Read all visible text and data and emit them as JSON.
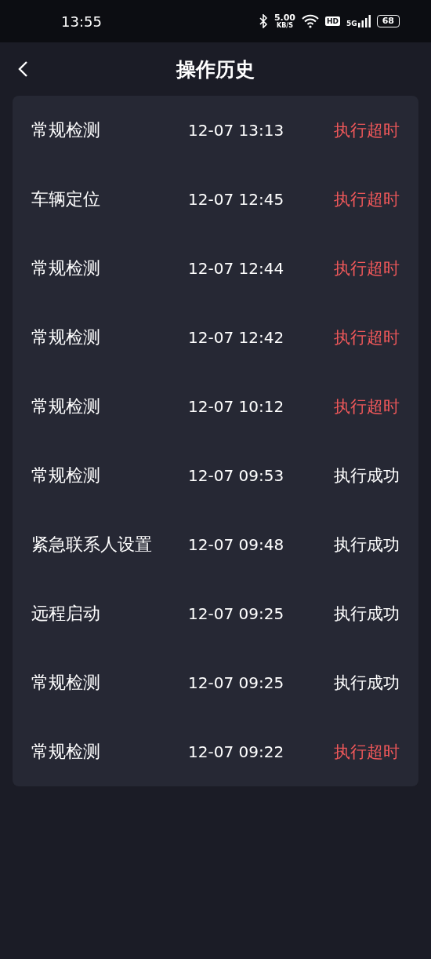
{
  "status_bar": {
    "time": "13:55",
    "speed": "5.00",
    "speed_unit": "KB/S",
    "hd": "HD",
    "network": "5G",
    "battery": "68"
  },
  "header": {
    "title": "操作历史"
  },
  "rows": [
    {
      "name": "常规检测",
      "time": "12-07 13:13",
      "result": "执行超时",
      "kind": "timeout"
    },
    {
      "name": "车辆定位",
      "time": "12-07 12:45",
      "result": "执行超时",
      "kind": "timeout"
    },
    {
      "name": "常规检测",
      "time": "12-07 12:44",
      "result": "执行超时",
      "kind": "timeout"
    },
    {
      "name": "常规检测",
      "time": "12-07 12:42",
      "result": "执行超时",
      "kind": "timeout"
    },
    {
      "name": "常规检测",
      "time": "12-07 10:12",
      "result": "执行超时",
      "kind": "timeout"
    },
    {
      "name": "常规检测",
      "time": "12-07 09:53",
      "result": "执行成功",
      "kind": "success"
    },
    {
      "name": "紧急联系人设置",
      "time": "12-07 09:48",
      "result": "执行成功",
      "kind": "success"
    },
    {
      "name": "远程启动",
      "time": "12-07 09:25",
      "result": "执行成功",
      "kind": "success"
    },
    {
      "name": "常规检测",
      "time": "12-07 09:25",
      "result": "执行成功",
      "kind": "success"
    },
    {
      "name": "常规检测",
      "time": "12-07 09:22",
      "result": "执行超时",
      "kind": "timeout"
    }
  ]
}
